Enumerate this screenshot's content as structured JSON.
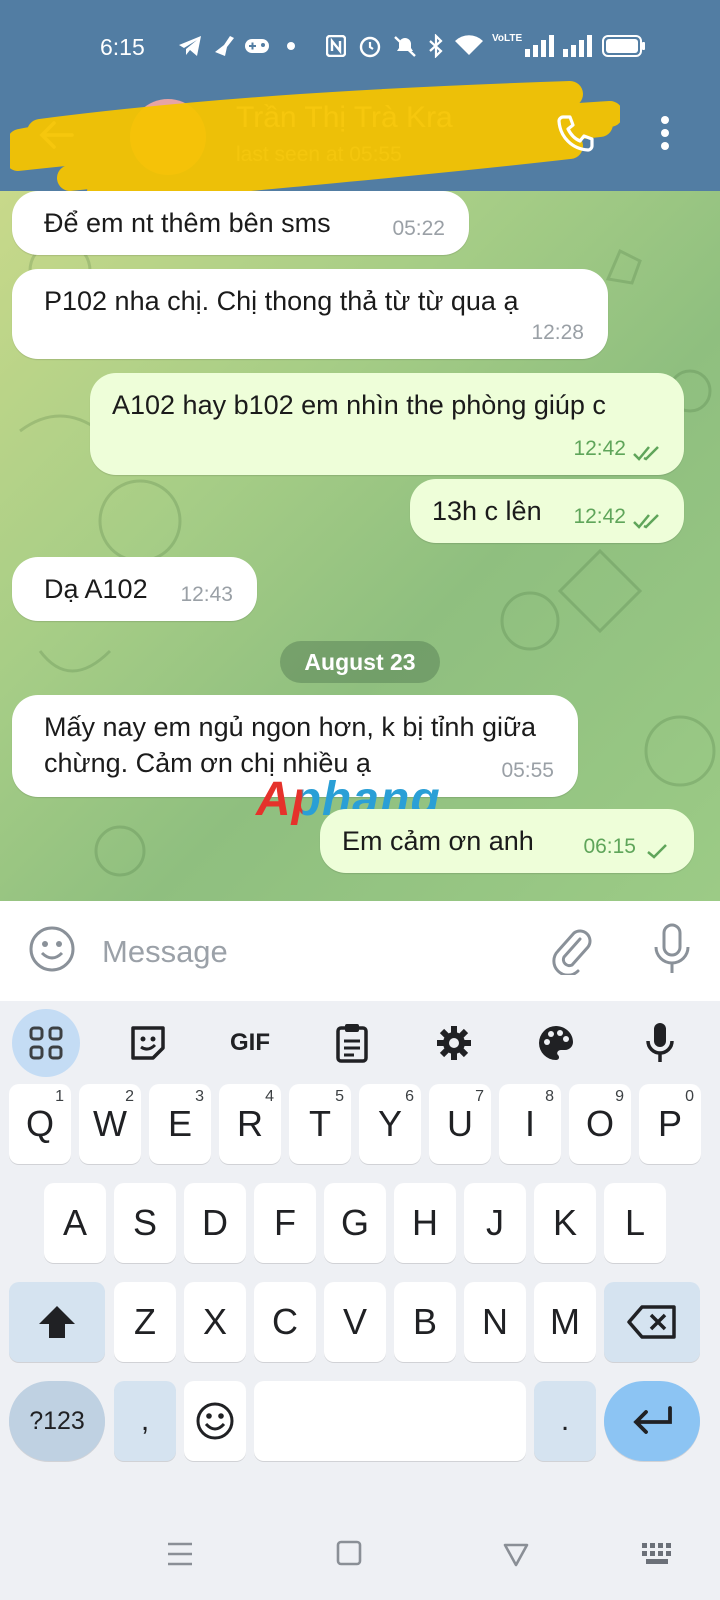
{
  "status_bar": {
    "time": "6:15",
    "battery_icon": "battery-full-icon"
  },
  "header": {
    "contact_name": "Trần Thị Trà Kra",
    "contact_status": "last seen at 05:55"
  },
  "messages": [
    {
      "text": "Để em nt thêm bên sms",
      "time": "05:22",
      "direction": "incoming"
    },
    {
      "text": "P102 nha chị. Chị thong thả từ từ qua ạ",
      "time": "12:28",
      "direction": "incoming"
    },
    {
      "text": "A102 hay b102 em nhìn the phòng giúp c",
      "time": "12:42",
      "direction": "outgoing",
      "status": "read"
    },
    {
      "text": "13h c lên",
      "time": "12:42",
      "direction": "outgoing",
      "status": "read"
    },
    {
      "text": "Dạ A102",
      "time": "12:43",
      "direction": "incoming"
    },
    {
      "text": "Mấy nay em ngủ ngon hơn, k bị tỉnh giữa chừng. Cảm ơn chị nhiều ạ",
      "time": "05:55",
      "direction": "incoming"
    },
    {
      "text": "Em cảm ơn anh",
      "time": "06:15",
      "direction": "outgoing",
      "status": "sent"
    }
  ],
  "date_divider": "August 23",
  "watermark": "Aphang",
  "input": {
    "placeholder": "Message"
  },
  "keyboard": {
    "toolbar": {
      "gif_label": "GIF"
    },
    "row1": [
      {
        "k": "Q",
        "h": "1"
      },
      {
        "k": "W",
        "h": "2"
      },
      {
        "k": "E",
        "h": "3"
      },
      {
        "k": "R",
        "h": "4"
      },
      {
        "k": "T",
        "h": "5"
      },
      {
        "k": "Y",
        "h": "6"
      },
      {
        "k": "U",
        "h": "7"
      },
      {
        "k": "I",
        "h": "8"
      },
      {
        "k": "O",
        "h": "9"
      },
      {
        "k": "P",
        "h": "0"
      }
    ],
    "row2": [
      "A",
      "S",
      "D",
      "F",
      "G",
      "H",
      "J",
      "K",
      "L"
    ],
    "row3": [
      "Z",
      "X",
      "C",
      "V",
      "B",
      "N",
      "M"
    ],
    "symbols_label": "?123",
    "comma": ",",
    "period": "."
  },
  "colors": {
    "header": "#527da3",
    "outgoing_bubble": "#eefed9",
    "incoming_bubble": "#ffffff",
    "accent": "#5fa55a"
  }
}
